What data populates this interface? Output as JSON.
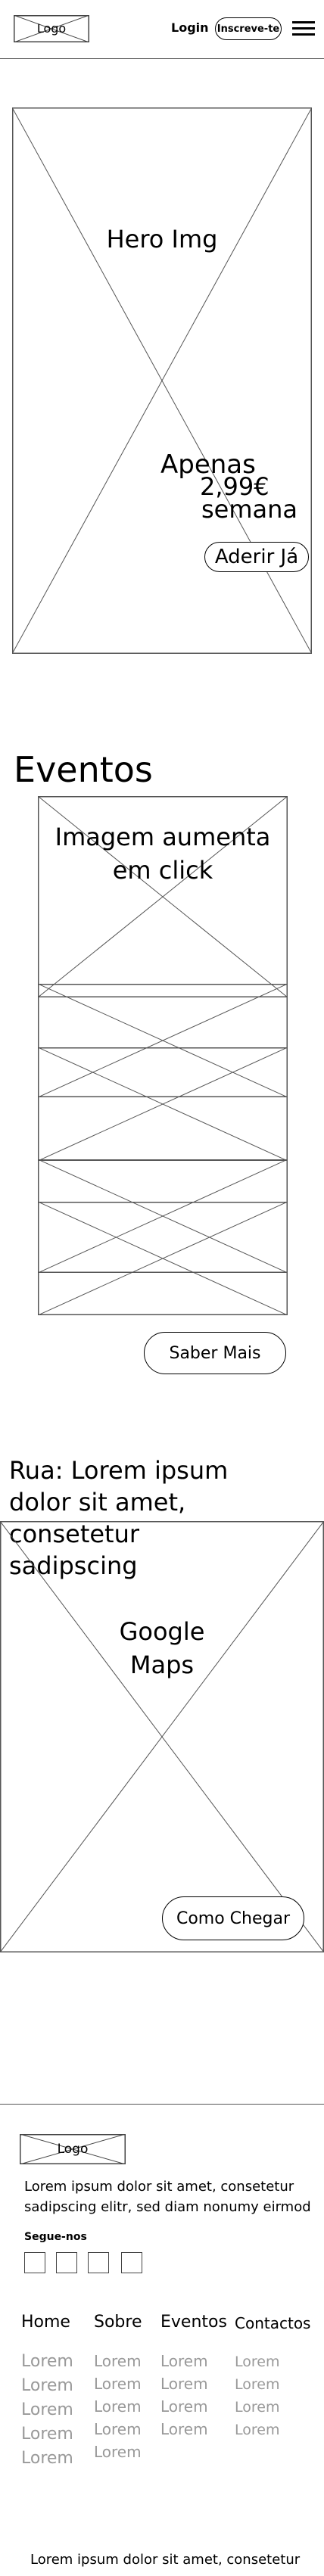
{
  "header": {
    "logo": "Logo",
    "login": "Login",
    "signup": "Inscreve-te",
    "menu_icon": "hamburger-menu-icon"
  },
  "hero": {
    "placeholder": "Hero Img",
    "price_prefix": "Apenas",
    "price_value": "2,99€",
    "price_suffix": "semana",
    "cta": "Aderir Já"
  },
  "events": {
    "title": "Eventos",
    "caption": "Imagem aumenta em click",
    "more_button": "Saber Mais"
  },
  "location": {
    "address": "Rua: Lorem ipsum dolor sit amet, consetetur sadipscing",
    "map_placeholder": "Google Maps",
    "directions_button": "Como Chegar"
  },
  "footer": {
    "logo": "Logo",
    "description": "Lorem ipsum dolor sit amet, consetetur sadipscing elitr, sed diam nonumy eirmod",
    "follow_label": "Segue-nos",
    "columns": [
      {
        "heading": "Home",
        "links": [
          "Lorem",
          "Lorem",
          "Lorem",
          "Lorem",
          "Lorem"
        ]
      },
      {
        "heading": "Sobre",
        "links": [
          "Lorem",
          "Lorem",
          "Lorem",
          "Lorem",
          "Lorem"
        ]
      },
      {
        "heading": "Eventos",
        "links": [
          "Lorem",
          "Lorem",
          "Lorem",
          "Lorem"
        ]
      },
      {
        "heading": "Contactos",
        "links": [
          "Lorem",
          "Lorem",
          "Lorem",
          "Lorem"
        ]
      }
    ],
    "bottom_text": "Lorem ipsum dolor sit amet, consetetur"
  }
}
